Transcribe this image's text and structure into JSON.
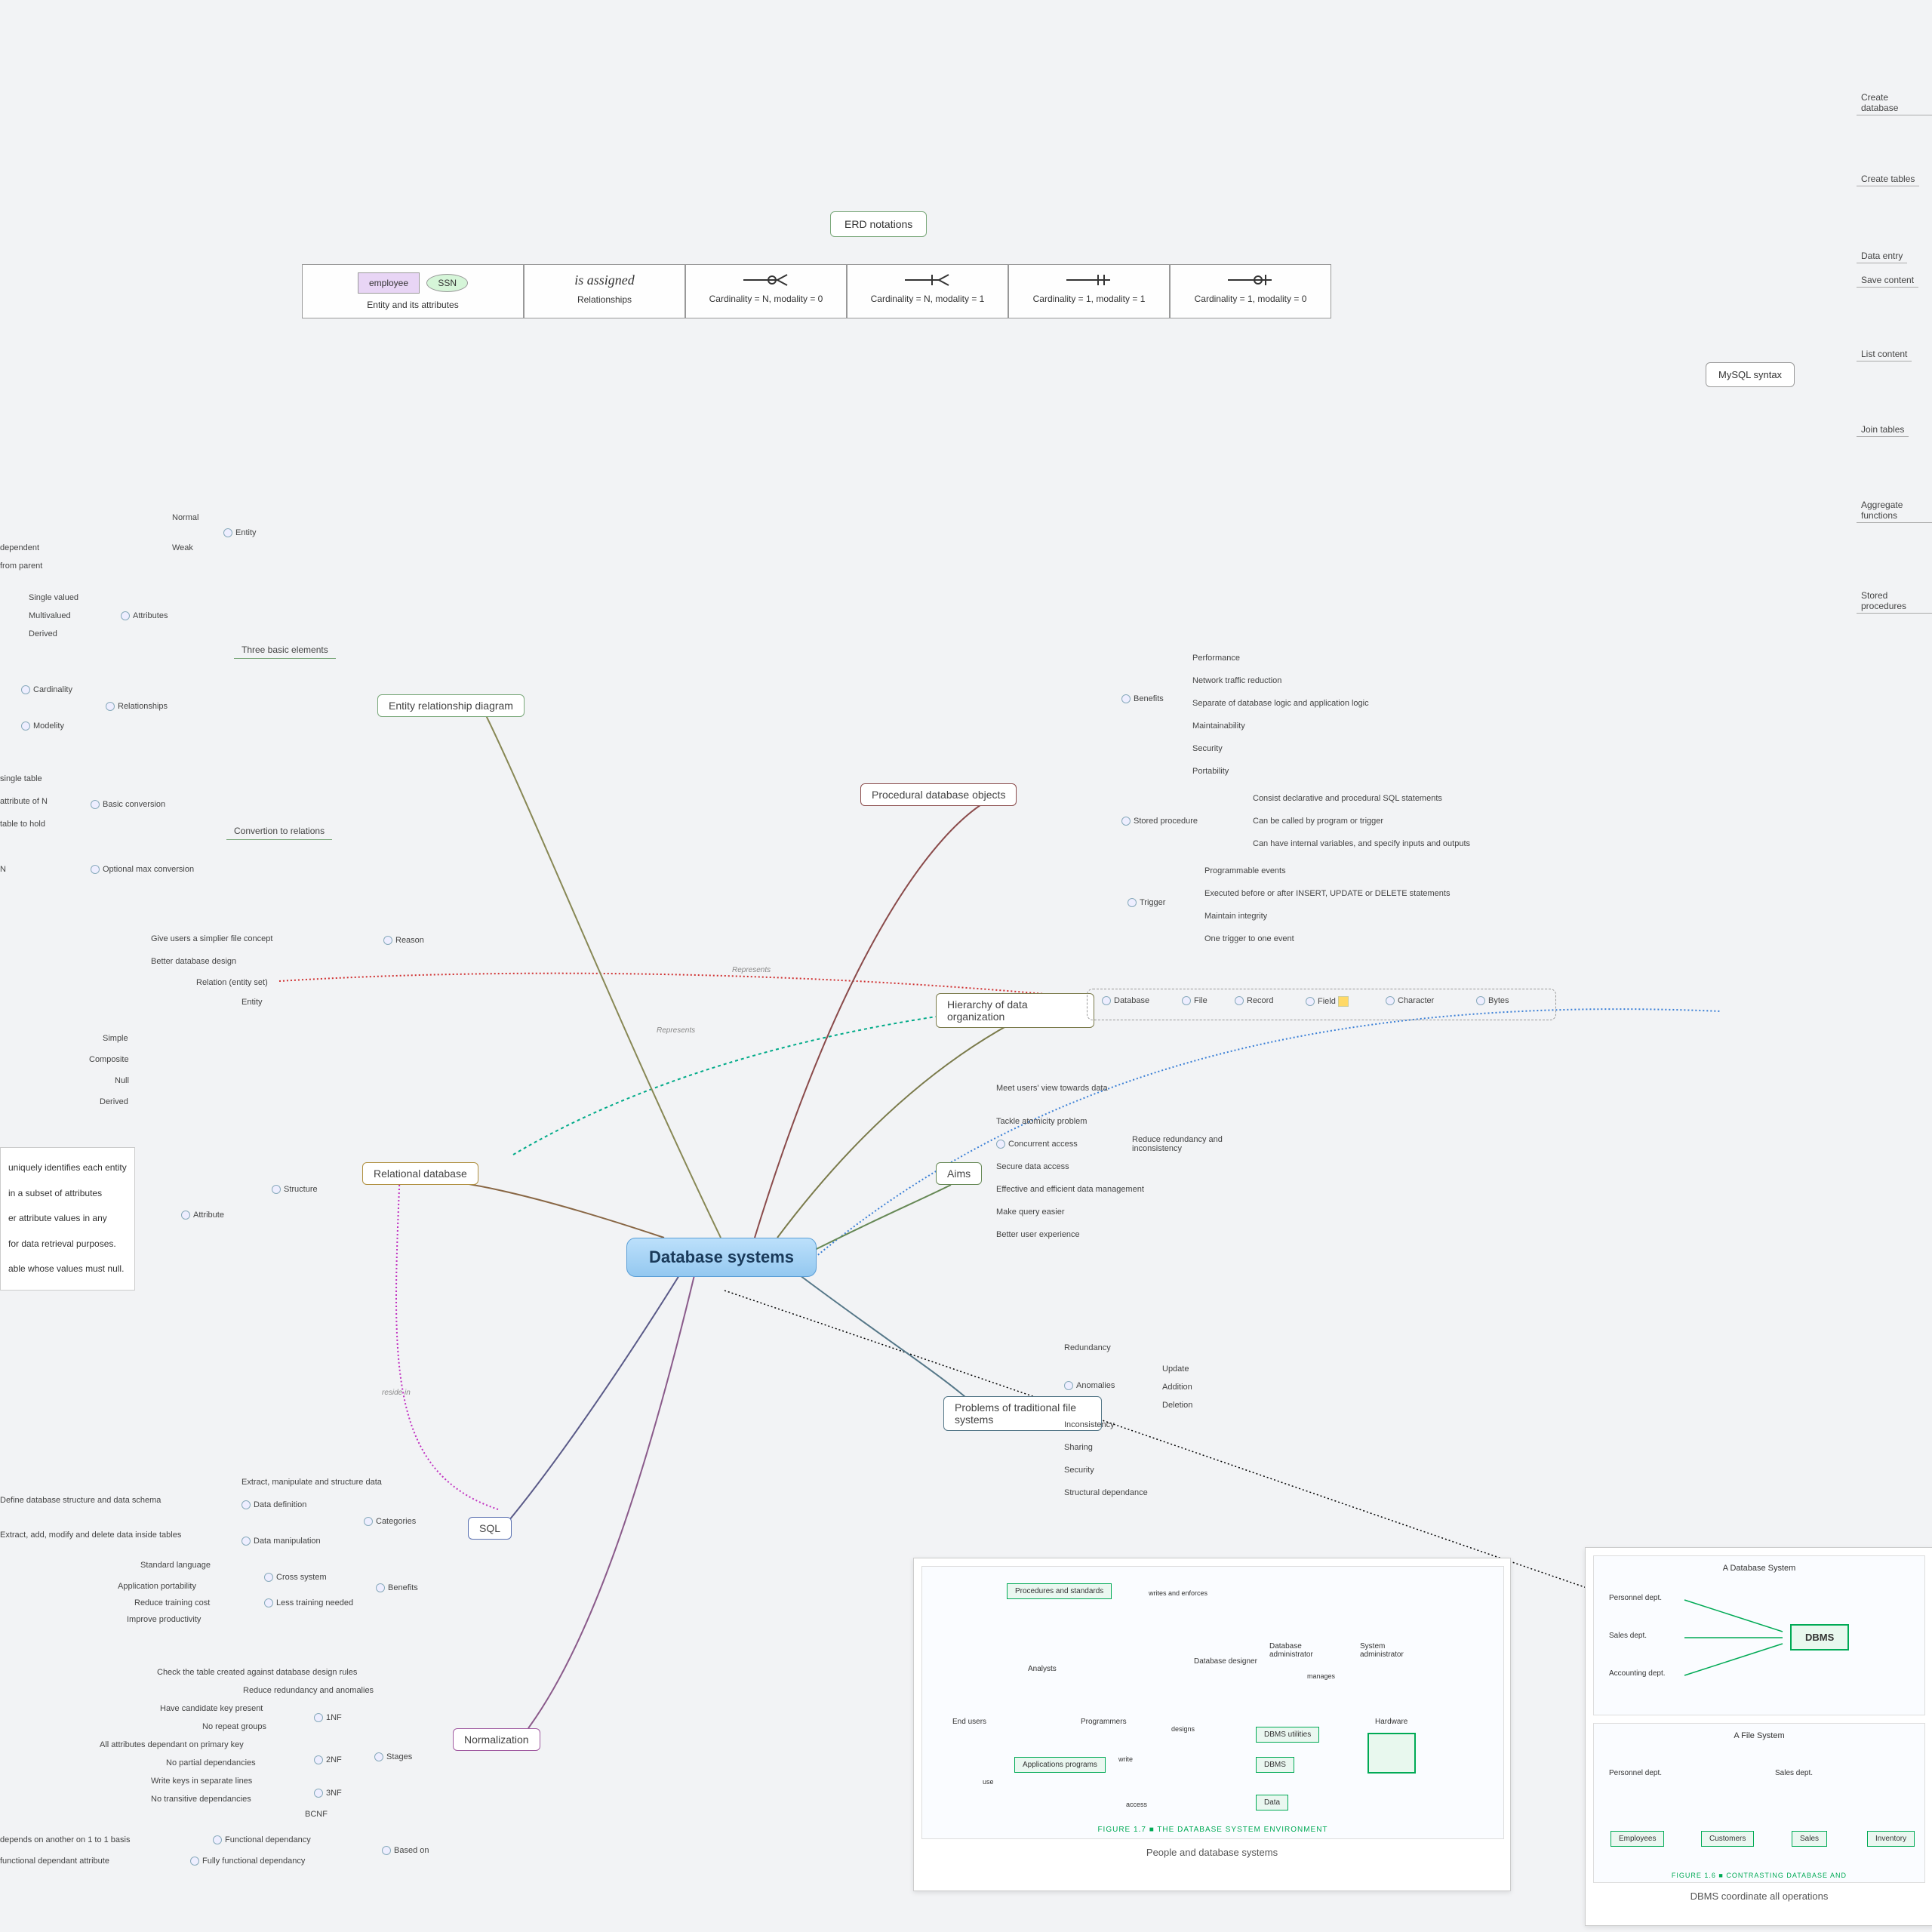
{
  "central": "Database systems",
  "erd": {
    "title": "ERD notations",
    "cells": [
      {
        "caption": "Entity and its attributes",
        "employee": "employee",
        "ssn": "SSN"
      },
      {
        "caption": "Relationships",
        "text": "is assigned"
      },
      {
        "caption": "Cardinality = N, modality = 0"
      },
      {
        "caption": "Cardinality = N, modality = 1"
      },
      {
        "caption": "Cardinality = 1, modality = 1"
      },
      {
        "caption": "Cardinality = 1, modality = 0"
      }
    ]
  },
  "mysql": {
    "title": "MySQL syntax",
    "items": [
      "Create database",
      "Create tables",
      "Data entry",
      "Save content",
      "List content",
      "Join tables",
      "Aggregate functions",
      "Stored procedures"
    ]
  },
  "er_diagram": {
    "title": "Entity relationship diagram",
    "three_basic": "Three basic elements",
    "entity": "Entity",
    "entity_types": [
      "Normal",
      "Weak"
    ],
    "entity_notes": [
      "dependent",
      "from parent"
    ],
    "attributes": "Attributes",
    "attribute_types": [
      "Single valued",
      "Multivalued",
      "Derived"
    ],
    "relationships": "Relationships",
    "rel_types": [
      "Cardinality",
      "Modelity"
    ],
    "conversion": "Convertion to relations",
    "basic_conv": "Basic conversion",
    "basic_conv_items": [
      "single table",
      "attribute of N",
      "table to hold"
    ],
    "optional_conv": "Optional max conversion",
    "optional_conv_items": [
      "N"
    ]
  },
  "relational": {
    "title": "Relational database",
    "structure": "Structure",
    "reason": "Reason",
    "reason_items": [
      "Give users a simplier file concept",
      "Better database design"
    ],
    "struct_items": [
      "Relation (entity set)",
      "Entity"
    ],
    "attribute": "Attribute",
    "attr_items": [
      "Simple",
      "Composite",
      "Null",
      "Derived"
    ],
    "key_items": [
      "uniquely identifies each entity",
      "in a subset of attributes",
      "er attribute values in any",
      "for data retrieval purposes.",
      "able whose values must null."
    ]
  },
  "sql": {
    "title": "SQL",
    "extract": "Extract, manipulate and structure data",
    "categories": "Categories",
    "cat_items": [
      "Data definition",
      "Data manipulation"
    ],
    "cat_desc": [
      "Define database structure and data schema",
      "Extract, add, modify and delete data inside tables"
    ],
    "benefits": "Benefits",
    "benefit_items": [
      "Cross system",
      "Less training needed"
    ],
    "benefit_sub": [
      "Standard language",
      "Application portability",
      "Reduce training cost",
      "Improve productivity"
    ]
  },
  "normalization": {
    "title": "Normalization",
    "check": "Check the table created against database design rules",
    "reduce": "Reduce redundancy and anomalies",
    "stages": "Stages",
    "stage_items": [
      "1NF",
      "2NF",
      "3NF",
      "BCNF"
    ],
    "nf1": [
      "Have candidate key present",
      "No repeat groups"
    ],
    "nf2": [
      "All attributes dependant on primary key",
      "No partial dependancies",
      "Write keys in separate lines"
    ],
    "nf3": [
      "No transitive dependancies"
    ],
    "based": "Based on",
    "based_items": [
      "Functional dependancy",
      "Fully functional dependancy"
    ],
    "based_desc": [
      "depends on another on 1 to 1 basis",
      "functional dependant attribute"
    ]
  },
  "procedural": {
    "title": "Procedural database objects",
    "benefits": "Benefits",
    "benefit_items": [
      "Performance",
      "Network traffic reduction",
      "Separate of database logic and application logic",
      "Maintainability",
      "Security",
      "Portability"
    ],
    "stored": "Stored procedure",
    "stored_items": [
      "Consist declarative and procedural SQL statements",
      "Can be called by program or trigger",
      "Can have internal variables, and specify inputs and outputs"
    ],
    "trigger": "Trigger",
    "trigger_items": [
      "Programmable events",
      "Executed before or after INSERT, UPDATE or DELETE statements",
      "Maintain integrity",
      "One trigger to one event"
    ]
  },
  "hierarchy": {
    "title": "Hierarchy of data organization",
    "items": [
      "Database",
      "File",
      "Record",
      "Field",
      "Character",
      "Bytes"
    ]
  },
  "aims": {
    "title": "Aims",
    "items": [
      "Meet users' view towards data",
      "Tackle atomicity problem",
      "Concurrent access",
      "Secure data access",
      "Effective and efficient data management",
      "Make query easier",
      "Better user experience"
    ],
    "concurrent_sub": "Reduce redundancy and inconsistency"
  },
  "problems": {
    "title": "Problems of traditional file systems",
    "items": [
      "Redundancy",
      "Anomalies",
      "Inconsistency",
      "Sharing",
      "Security",
      "Structural dependance"
    ],
    "anomaly_items": [
      "Update",
      "Addition",
      "Deletion"
    ]
  },
  "people": {
    "caption": "People and database systems",
    "fig_title": "FIGURE 1.7  ■  THE DATABASE SYSTEM ENVIRONMENT",
    "labels": [
      "Procedures and standards",
      "writes and enforces",
      "Analysts",
      "Database designer",
      "Database administrator",
      "System administrator",
      "manages",
      "End users",
      "Programmers",
      "Applications programs",
      "use",
      "write",
      "designs",
      "DBMS utilities",
      "DBMS",
      "Data",
      "access",
      "Hardware"
    ]
  },
  "dbms_fig": {
    "caption": "DBMS coordinate all operations",
    "fig_title": "FIGURE 1.6  ■  CONTRASTING DATABASE AND",
    "db_title": "A Database System",
    "file_title": "A File System",
    "depts": [
      "Personnel dept.",
      "Sales dept.",
      "Accounting dept."
    ],
    "dbms": "DBMS",
    "file_boxes": [
      "Employees",
      "Customers",
      "Sales",
      "Inventory"
    ]
  },
  "edge_labels": {
    "represents1": "Represents",
    "represents2": "Represents",
    "reside": "reside in"
  }
}
